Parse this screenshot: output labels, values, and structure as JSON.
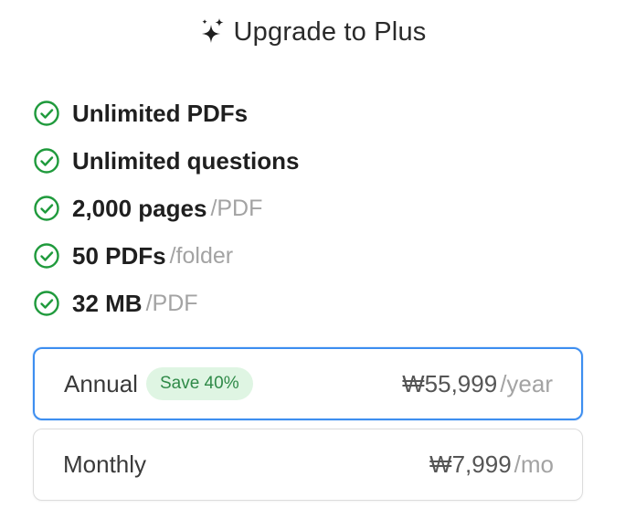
{
  "header": {
    "icon": "sparkles-icon",
    "title": "Upgrade to Plus"
  },
  "features": [
    {
      "text": "Unlimited PDFs",
      "unit": ""
    },
    {
      "text": "Unlimited questions",
      "unit": ""
    },
    {
      "text": "2,000 pages",
      "unit": "/PDF"
    },
    {
      "text": "50 PDFs",
      "unit": "/folder"
    },
    {
      "text": "32 MB",
      "unit": "/PDF"
    }
  ],
  "plans": {
    "annual": {
      "name": "Annual",
      "badge": "Save 40%",
      "price": "₩55,999",
      "period": "/year",
      "selected": true
    },
    "monthly": {
      "name": "Monthly",
      "price": "₩7,999",
      "period": "/mo",
      "selected": false
    }
  },
  "colors": {
    "check": "#1f9a3c",
    "selected_border": "#3d8ef0",
    "badge_bg": "#dff5e3",
    "badge_text": "#2f8a48",
    "muted": "#a3a3a3"
  }
}
